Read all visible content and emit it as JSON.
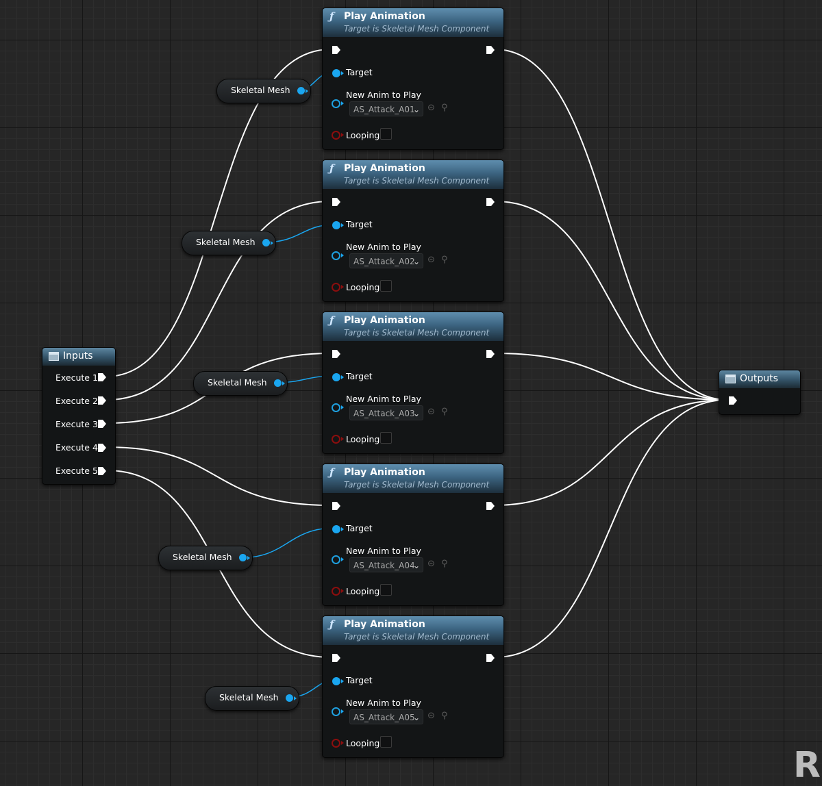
{
  "colors": {
    "exec_wire": "#ffffff",
    "object_wire": "#1aa6f0",
    "boolean_pin": "#8c0e0e",
    "header_blue": "#3c6481"
  },
  "inputs": {
    "title": "Inputs",
    "icon": "tunnel-icon",
    "pins": [
      "Execute 1",
      "Execute 2",
      "Execute 3",
      "Execute 4",
      "Execute 5"
    ]
  },
  "outputs": {
    "title": "Outputs",
    "icon": "tunnel-icon"
  },
  "variable_label": "Skeletal Mesh",
  "play_nodes": [
    {
      "title": "Play Animation",
      "subtitle": "Target is Skeletal Mesh Component",
      "target": "Target",
      "new_anim": "New Anim to Play",
      "asset": "AS_Attack_A01",
      "looping": "Looping"
    },
    {
      "title": "Play Animation",
      "subtitle": "Target is Skeletal Mesh Component",
      "target": "Target",
      "new_anim": "New Anim to Play",
      "asset": "AS_Attack_A02",
      "looping": "Looping"
    },
    {
      "title": "Play Animation",
      "subtitle": "Target is Skeletal Mesh Component",
      "target": "Target",
      "new_anim": "New Anim to Play",
      "asset": "AS_Attack_A03",
      "looping": "Looping"
    },
    {
      "title": "Play Animation",
      "subtitle": "Target is Skeletal Mesh Component",
      "target": "Target",
      "new_anim": "New Anim to Play",
      "asset": "AS_Attack_A04",
      "looping": "Looping"
    },
    {
      "title": "Play Animation",
      "subtitle": "Target is Skeletal Mesh Component",
      "target": "Target",
      "new_anim": "New Anim to Play",
      "asset": "AS_Attack_A05",
      "looping": "Looping"
    }
  ],
  "skeletal_mesh_nodes": [
    {
      "label": "Skeletal Mesh"
    },
    {
      "label": "Skeletal Mesh"
    },
    {
      "label": "Skeletal Mesh"
    },
    {
      "label": "Skeletal Mesh"
    },
    {
      "label": "Skeletal Mesh"
    }
  ],
  "watermark": "R",
  "icons": {
    "function": "function-icon",
    "exec": "exec-pin-icon",
    "object": "object-pin-icon",
    "boolean": "boolean-pin-icon",
    "use_selected": "use-selected-asset-icon",
    "browse": "browse-asset-icon",
    "chevron": "chevron-down-icon"
  }
}
